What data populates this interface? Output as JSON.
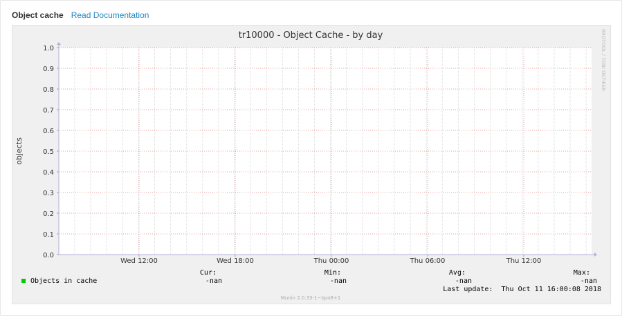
{
  "header": {
    "title": "Object cache",
    "doc_link": "Read Documentation"
  },
  "chart_data": {
    "type": "line",
    "title": "tr10000 - Object Cache - by day",
    "ylabel": "objects",
    "xlabel": "",
    "ylim": [
      0,
      1.0
    ],
    "y_ticks": [
      "0.0",
      "0.1",
      "0.2",
      "0.3",
      "0.4",
      "0.5",
      "0.6",
      "0.7",
      "0.8",
      "0.9",
      "1.0"
    ],
    "x_ticks": [
      "Wed 12:00",
      "Wed 18:00",
      "Thu 00:00",
      "Thu 06:00",
      "Thu 12:00"
    ],
    "series": [
      {
        "name": "Objects in cache",
        "color": "#00cc00",
        "values": []
      }
    ],
    "grid": true,
    "legend_position": "bottom-left",
    "stats": {
      "headers": [
        "Cur:",
        "Min:",
        "Avg:",
        "Max:"
      ],
      "values": [
        "-nan",
        "-nan",
        "-nan",
        "-nan"
      ]
    },
    "last_update": "Last update:  Thu Oct 11 16:00:08 2018",
    "watermark": "RRDTOOL / TOBI OETIKER",
    "footer": "Munin 2.0.33-1~bpo8+1"
  }
}
